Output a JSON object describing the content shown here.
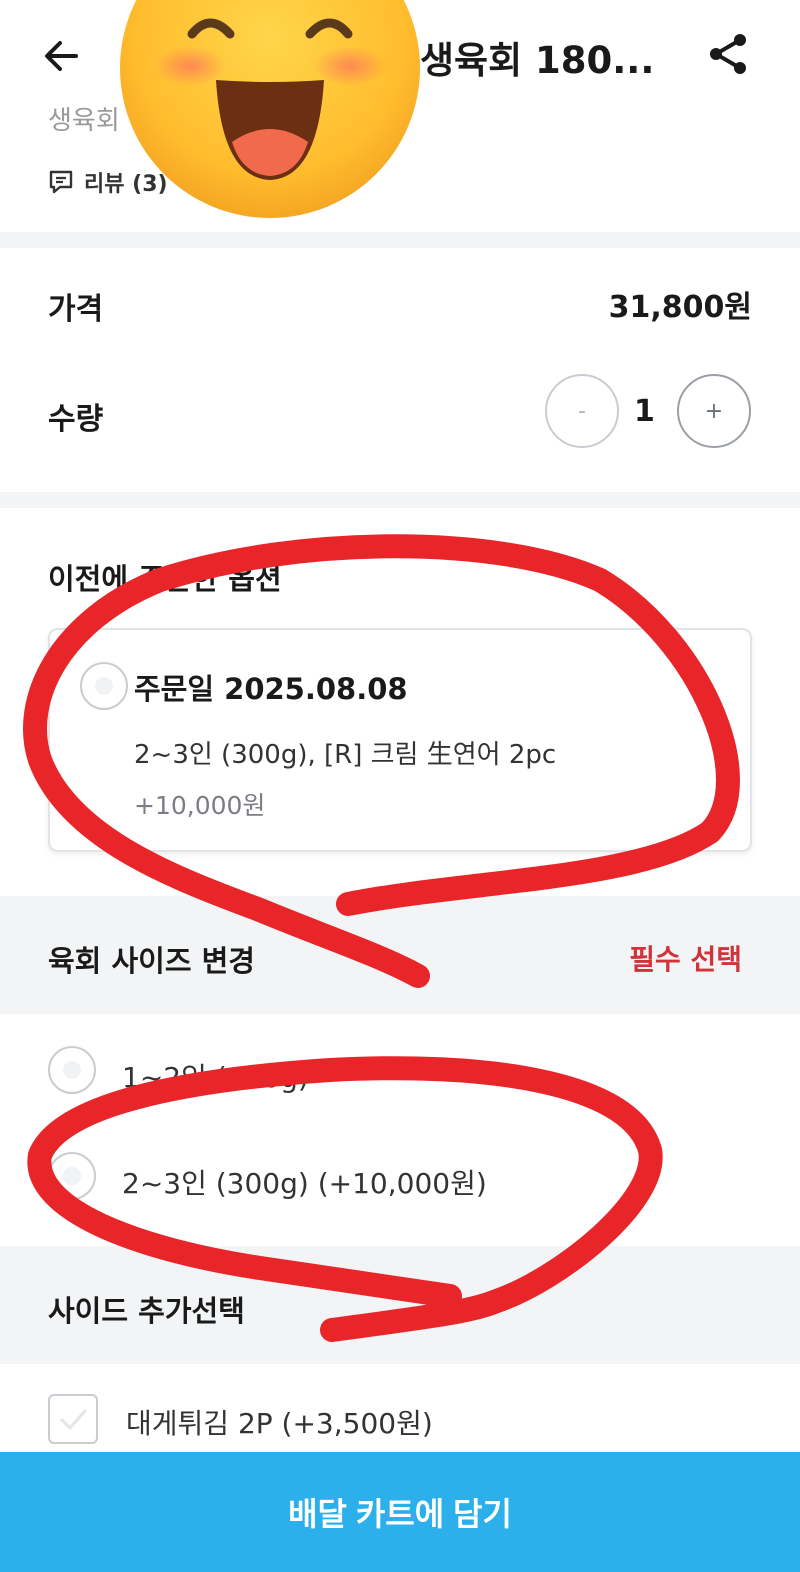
{
  "header": {
    "back_icon": "arrow-left-icon",
    "title": "생육회 180...",
    "share_icon": "share-icon",
    "subtitle": "생육회",
    "review_icon": "chat-icon",
    "review_label": "리뷰 (3)",
    "overlay_emoji": "grinning-face-emoji"
  },
  "price": {
    "label": "가격",
    "value": "31,800원"
  },
  "quantity": {
    "label": "수량",
    "minus": "-",
    "value": "1",
    "plus": "+"
  },
  "previous_order": {
    "title": "이전에 주문한 옵션",
    "date": "주문일 2025.08.08",
    "description": "2~3인 (300g), [R] 크림 生연어 2pc",
    "price": "+10,000원"
  },
  "size_section": {
    "title": "육회 사이즈 변경",
    "badge": "필수 선택",
    "badge_color": "#d0343a",
    "options": [
      {
        "label": "1~2인 (100g)"
      },
      {
        "label": "2~3인 (300g) (+10,000원)"
      }
    ]
  },
  "side_section": {
    "title": "사이드 추가선택",
    "options": [
      {
        "label": "대게튀김 2P (+3,500원)"
      }
    ]
  },
  "cart_button": {
    "label": "배달 카트에 담기",
    "color": "#2bb0ec"
  },
  "annotation_color": "#e8262a"
}
